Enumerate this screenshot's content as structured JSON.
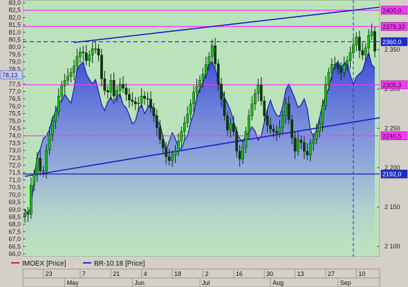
{
  "chart_data": {
    "type": "candlestick+area",
    "left_axis": {
      "series": "BR-10.18",
      "min": 66.0,
      "max": 83.0,
      "step": 0.5,
      "current_value_label": "78,13",
      "ticks": [
        "66,0",
        "66,5",
        "67,0",
        "67,5",
        "68,0",
        "68,5",
        "69,0",
        "69,5",
        "70,0",
        "70,5",
        "71,0",
        "71,5",
        "72,0",
        "72,5",
        "73,0",
        "73,5",
        "74,0",
        "74,5",
        "75,0",
        "75,5",
        "76,0",
        "76,5",
        "77,0",
        "77,5",
        "78,0",
        "78,5",
        "79,0",
        "79,5",
        "80,0",
        "80,5",
        "81,0",
        "81,5",
        "82,0",
        "82,5",
        "83,0"
      ]
    },
    "right_axis": {
      "series": "IMOEX",
      "ticks": [
        "2 100",
        "2 150",
        "2 200",
        "2 250",
        "2 300",
        "2 350"
      ],
      "min": 2087,
      "max": 2413
    },
    "x_axis": {
      "day_ticks": [
        {
          "label": "23",
          "i": 6
        },
        {
          "label": "7",
          "i": 18
        },
        {
          "label": "21",
          "i": 28
        },
        {
          "label": "4",
          "i": 38
        },
        {
          "label": "18",
          "i": 48
        },
        {
          "label": "2",
          "i": 58
        },
        {
          "label": "16",
          "i": 68
        },
        {
          "label": "30",
          "i": 78
        },
        {
          "label": "13",
          "i": 88
        },
        {
          "label": "27",
          "i": 98
        },
        {
          "label": "10",
          "i": 108
        }
      ],
      "month_ticks": [
        {
          "label": "May",
          "i": 13
        },
        {
          "label": "Jun",
          "i": 35
        },
        {
          "label": "Jul",
          "i": 57
        },
        {
          "label": "Aug",
          "i": 80
        },
        {
          "label": "Sep",
          "i": 102
        }
      ]
    },
    "horizontal_levels": [
      {
        "label": "2400,0",
        "value": 2400.0,
        "color": "#ff33ff"
      },
      {
        "label": "2379,33",
        "value": 2379.33,
        "color": "#ff33ff"
      },
      {
        "label": "2360,0",
        "value": 2360.0,
        "color": "#2f2fd0",
        "dashed": true
      },
      {
        "label": "2305,3",
        "value": 2305.3,
        "color": "#ff33ff"
      },
      {
        "label": "2240,5",
        "value": 2240.5,
        "color": "#ff33ff"
      },
      {
        "label": "2192,0",
        "value": 2192.0,
        "color": "#2020c0"
      }
    ],
    "trend_lines": [
      {
        "from": {
          "i": 16,
          "value": 2359
        },
        "to": {
          "i": 118,
          "value": 2405
        }
      },
      {
        "from": {
          "i": 0,
          "value": 2189
        },
        "to": {
          "i": 118,
          "value": 2265
        }
      }
    ],
    "vertical_marker_i": 107,
    "legend": [
      {
        "name": "IMOEX [Price]",
        "color": "#e02020"
      },
      {
        "name": "BR-10.18 [Price]",
        "color": "#2030c0"
      }
    ],
    "brent_close": [
      69.0,
      68.7,
      69.2,
      71.1,
      72.6,
      73.1,
      73.8,
      74.0,
      74.4,
      75.2,
      75.6,
      76.2,
      76.4,
      76.8,
      76.5,
      76.2,
      77.2,
      78.5,
      78.8,
      79.0,
      78.2,
      77.8,
      77.5,
      77.8,
      77.0,
      76.1,
      75.7,
      76.3,
      76.6,
      76.2,
      76.7,
      76.8,
      76.1,
      75.9,
      75.4,
      74.8,
      75.0,
      75.8,
      76.1,
      75.5,
      75.9,
      76.2,
      75.7,
      75.0,
      74.8,
      73.9,
      73.0,
      73.6,
      74.2,
      73.8,
      73.2,
      73.1,
      73.7,
      74.0,
      74.9,
      75.5,
      76.6,
      77.2,
      77.6,
      78.2,
      78.9,
      79.0,
      78.5,
      77.8,
      77.2,
      76.6,
      76.2,
      75.7,
      75.0,
      74.2,
      73.8,
      73.6,
      74.0,
      74.2,
      74.6,
      74.3,
      73.7,
      74.0,
      74.9,
      75.8,
      76.4,
      75.8,
      75.4,
      75.3,
      76.0,
      77.1,
      77.5,
      77.0,
      76.5,
      75.9,
      76.1,
      76.5,
      75.8,
      74.4,
      73.9,
      74.4,
      75.2,
      76.1,
      76.7,
      77.2,
      78.1,
      78.8,
      79.0,
      78.6,
      78.9,
      79.0,
      78.1,
      77.5,
      78.0,
      78.2,
      78.4,
      79.1,
      79.6,
      78.8,
      78.6
    ],
    "imoex_close": [
      2142,
      2141,
      2178,
      2192,
      2212,
      2196,
      2196,
      2222,
      2242,
      2259,
      2271,
      2291,
      2304,
      2311,
      2316,
      2321,
      2329,
      2341,
      2347,
      2346,
      2336,
      2343,
      2351,
      2351,
      2343,
      2313,
      2298,
      2296,
      2311,
      2291,
      2298,
      2306,
      2301,
      2293,
      2286,
      2284,
      2281,
      2282,
      2291,
      2288,
      2287,
      2276,
      2266,
      2251,
      2236,
      2225,
      2214,
      2209,
      2216,
      2221,
      2234,
      2246,
      2257,
      2268,
      2281,
      2296,
      2303,
      2311,
      2319,
      2331,
      2341,
      2355,
      2332,
      2306,
      2287,
      2266,
      2248,
      2256,
      2246,
      2221,
      2211,
      2226,
      2246,
      2266,
      2281,
      2294,
      2305,
      2285,
      2266,
      2254,
      2249,
      2246,
      2244,
      2251,
      2266,
      2281,
      2261,
      2238,
      2221,
      2235,
      2232,
      2221,
      2216,
      2231,
      2236,
      2246,
      2256,
      2279,
      2306,
      2321,
      2331,
      2331,
      2326,
      2321,
      2331,
      2336,
      2346,
      2356,
      2366,
      2349,
      2343,
      2352,
      2368,
      2373,
      2348
    ]
  }
}
